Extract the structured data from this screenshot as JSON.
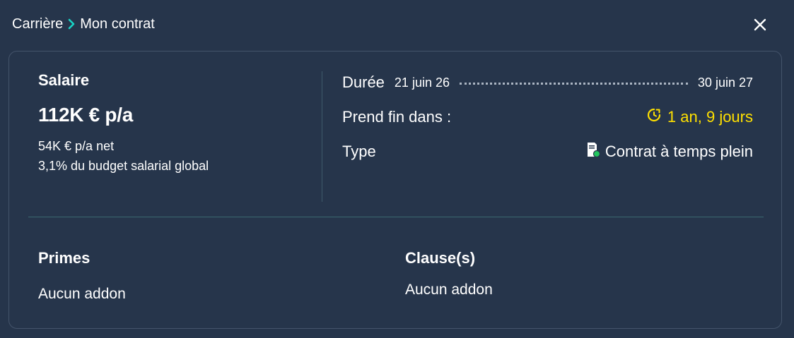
{
  "breadcrumb": {
    "parent": "Carrière",
    "current": "Mon contrat"
  },
  "icons": {
    "separator": "chevron-right-icon",
    "close": "close-icon",
    "clock": "clock-icon",
    "contract": "contract-document-icon"
  },
  "colors": {
    "background": "#26354b",
    "accent": "#19d3c5",
    "warning": "#ffe000",
    "status_green": "#22c55e"
  },
  "salary": {
    "title": "Salaire",
    "amount": "112K € p/a",
    "net": "54K € p/a net",
    "budget_share": "3,1% du budget salarial global"
  },
  "contract": {
    "duration_label": "Durée",
    "start_date": "21 juin 26",
    "end_date": "30 juin 27",
    "ends_in_label": "Prend fin dans :",
    "ends_in_value": "1 an, 9 jours",
    "type_label": "Type",
    "type_value": "Contrat à temps plein"
  },
  "bonuses": {
    "title": "Primes",
    "value": "Aucun addon"
  },
  "clauses": {
    "title": "Clause(s)",
    "value": "Aucun addon"
  }
}
